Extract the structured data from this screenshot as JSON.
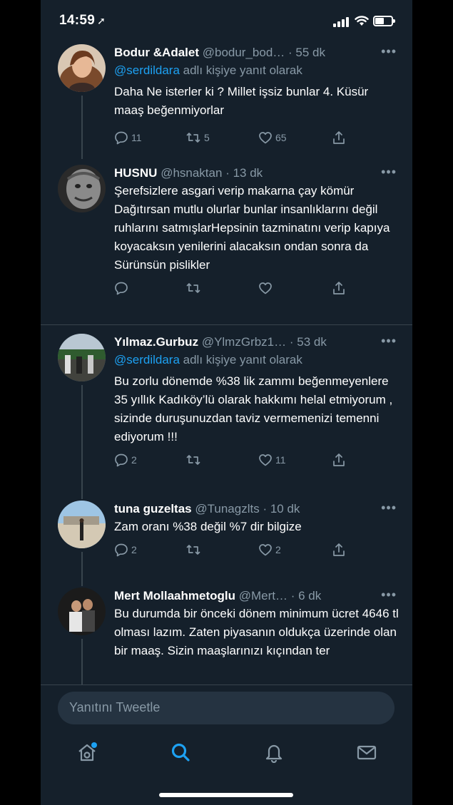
{
  "status_bar": {
    "time": "14:59"
  },
  "tweets": [
    {
      "name": "Bodur &Adalet",
      "handle": "@bodur_bod…",
      "time": "· 55 dk",
      "reply_to_mention": "@serdildara",
      "reply_to_suffix": " adlı kişiye yanıt olarak",
      "text": "Daha Ne isterler ki ?  Millet işsiz bunlar 4. Küsür maaş beğenmiyorlar",
      "replies": "11",
      "retweets": "5",
      "likes": "65"
    },
    {
      "name": "HUSNU",
      "handle": "@hsnaktan",
      "time": "· 13 dk",
      "text": "Şerefsizlere asgari verip makarna çay kömür Dağıtırsan mutlu olurlar bunlar insanlıklarını değil ruhlarını satmışlarHepsinin tazminatını verip kapıya koyacaksın yenilerini alacaksın ondan sonra da Sürünsün pislikler",
      "replies": "",
      "retweets": "",
      "likes": ""
    },
    {
      "name": "Yılmaz.Gurbuz",
      "handle": "@YlmzGrbz1…",
      "time": "· 53 dk",
      "reply_to_mention": "@serdildara",
      "reply_to_suffix": " adlı kişiye yanıt olarak",
      "text": "Bu zorlu dönemde %38 lik zammı beğenmeyenlere 35 yıllık Kadıköy’lü olarak hakkımı helal etmiyorum , sizinde duruşunuzdan taviz vermemenizi temenni ediyorum !!!",
      "replies": "2",
      "retweets": "",
      "likes": "11"
    },
    {
      "name": "tuna guzeltas",
      "handle": "@Tunagzlts",
      "time": "· 10 dk",
      "text": "Zam oranı %38  değil %7 dir bilgize",
      "replies": "2",
      "retweets": "",
      "likes": "2"
    },
    {
      "name": "Mert Mollaahmetoglu",
      "handle": "@Mert…",
      "time": "· 6 dk",
      "text": "Bu durumda bir önceki dönem minimum ücret 4646 tl olması lazım. Zaten piyasanın oldukça üzerinde olan bir maaş. Sizin maaşlarınızı kıçından ter"
    }
  ],
  "reply_box": {
    "placeholder": "Yanıtını Tweetle"
  },
  "tabs": [
    "home-icon",
    "search-icon",
    "notifications-icon",
    "messages-icon"
  ],
  "colors": {
    "background": "#15202b",
    "accent": "#1da1f2",
    "secondary_text": "#8899a6",
    "divider": "#38444d"
  }
}
